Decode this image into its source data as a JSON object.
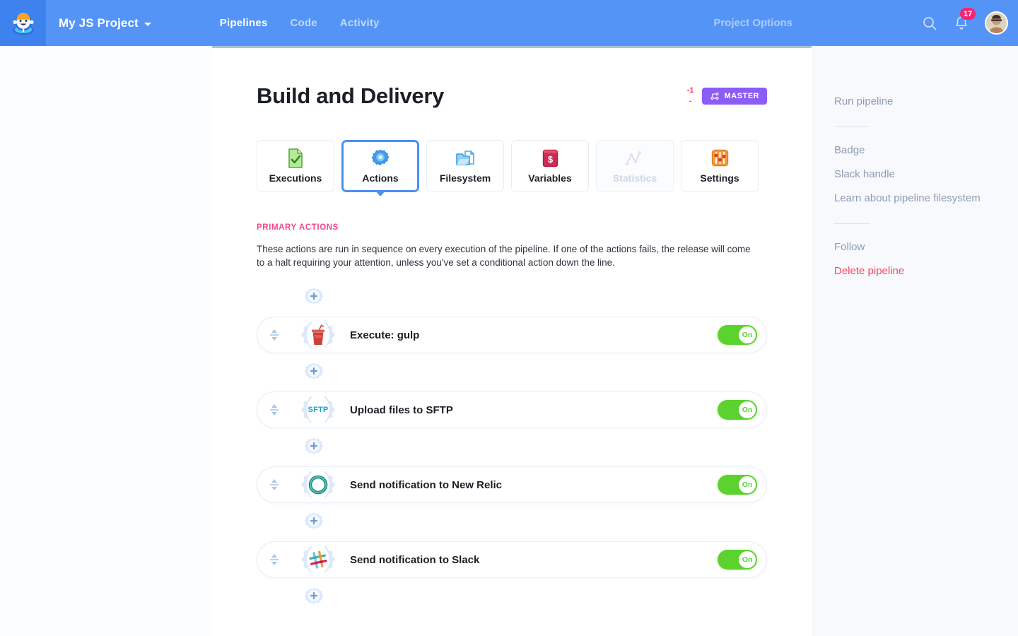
{
  "topbar": {
    "logo_icon": "buddy-mascot-logo",
    "project_name": "My JS Project",
    "nav": [
      {
        "label": "Pipelines",
        "active": true
      },
      {
        "label": "Code",
        "active": false
      },
      {
        "label": "Activity",
        "active": false
      }
    ],
    "project_options_label": "Project Options",
    "search_icon": "search-icon",
    "bell_icon": "bell-icon",
    "notification_count": "17",
    "avatar_icon": "user-avatar"
  },
  "header": {
    "title": "Build and Delivery",
    "diff_added": "-1",
    "diff_removed": "-",
    "branch_icon": "git-branch-icon",
    "branch_label": "MASTER",
    "branch_color": "#8b5cf6"
  },
  "tabs": [
    {
      "label": "Executions",
      "icon": "document-check-icon",
      "active": false,
      "disabled": false
    },
    {
      "label": "Actions",
      "icon": "gear-icon",
      "active": true,
      "disabled": false
    },
    {
      "label": "Filesystem",
      "icon": "folder-files-icon",
      "active": false,
      "disabled": false
    },
    {
      "label": "Variables",
      "icon": "dollar-box-icon",
      "active": false,
      "disabled": false
    },
    {
      "label": "Statistics",
      "icon": "line-chart-icon",
      "active": false,
      "disabled": true
    },
    {
      "label": "Settings",
      "icon": "sliders-icon",
      "active": false,
      "disabled": false
    }
  ],
  "section": {
    "heading": "PRIMARY ACTIONS",
    "heading_color": "#f5468b",
    "description": "These actions are run in sequence on every execution of the pipeline. If one of the actions fails, the release will come to a halt requiring your attention, unless you've set a conditional action down the line."
  },
  "actions": [
    {
      "name": "Execute: gulp",
      "icon": "gulp-icon",
      "toggle_state": "On"
    },
    {
      "name": "Upload files to SFTP",
      "icon": "sftp-icon",
      "toggle_state": "On"
    },
    {
      "name": "Send notification to New Relic",
      "icon": "new-relic-icon",
      "toggle_state": "On"
    },
    {
      "name": "Send notification to Slack",
      "icon": "slack-icon",
      "toggle_state": "On"
    }
  ],
  "add_button_icon": "plus-gear-icon",
  "drag_handle_icon": "drag-reorder-icon",
  "sidebar": {
    "group1": [
      {
        "label": "Run pipeline"
      }
    ],
    "group2": [
      {
        "label": "Badge"
      },
      {
        "label": "Slack handle"
      },
      {
        "label": "Learn about pipeline filesystem"
      }
    ],
    "group3": [
      {
        "label": "Follow",
        "danger": false
      },
      {
        "label": "Delete pipeline",
        "danger": true
      }
    ],
    "danger_color": "#f5465d"
  }
}
